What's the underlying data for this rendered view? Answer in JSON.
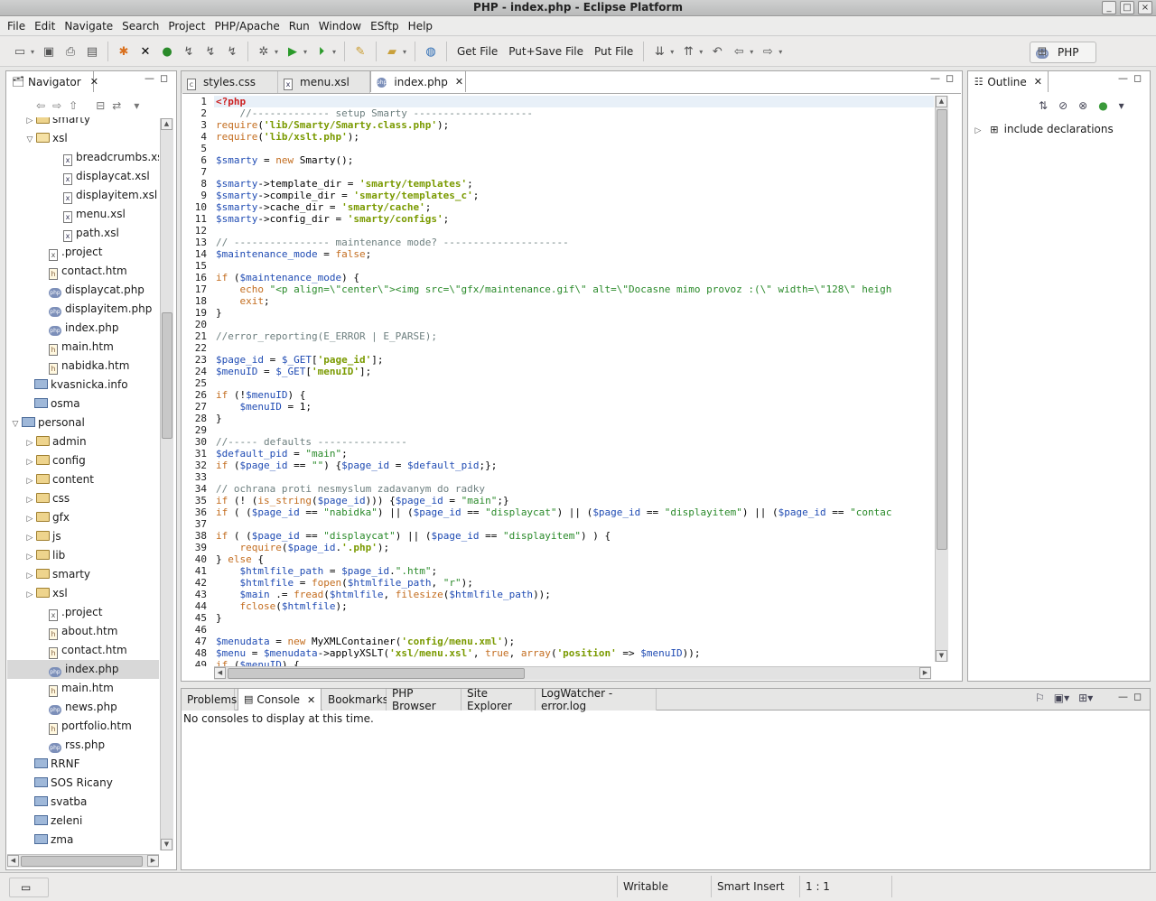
{
  "window": {
    "title": "PHP - index.php - Eclipse Platform"
  },
  "menu": [
    "File",
    "Edit",
    "Navigate",
    "Search",
    "Project",
    "PHP/Apache",
    "Run",
    "Window",
    "ESftp",
    "Help"
  ],
  "toolbar": {
    "get_file": "Get File",
    "put_save_file": "Put+Save File",
    "put_file": "Put File",
    "perspective": "PHP"
  },
  "navigator": {
    "title": "Navigator",
    "items": [
      {
        "label": "smarty",
        "type": "folder",
        "level": 1,
        "expander": "collapsed"
      },
      {
        "label": "xsl",
        "type": "folder",
        "level": 1,
        "expander": "expanded"
      },
      {
        "label": "breadcrumbs.xsl",
        "type": "xsl",
        "level": 2
      },
      {
        "label": "displaycat.xsl",
        "type": "xsl",
        "level": 2
      },
      {
        "label": "displayitem.xsl",
        "type": "xsl",
        "level": 2
      },
      {
        "label": "menu.xsl",
        "type": "xsl",
        "level": 2
      },
      {
        "label": "path.xsl",
        "type": "xsl",
        "level": 2
      },
      {
        "label": ".project",
        "type": "projectfile",
        "level": 1
      },
      {
        "label": "contact.htm",
        "type": "htm",
        "level": 1
      },
      {
        "label": "displaycat.php",
        "type": "php",
        "level": 1
      },
      {
        "label": "displayitem.php",
        "type": "php",
        "level": 1
      },
      {
        "label": "index.php",
        "type": "php",
        "level": 1
      },
      {
        "label": "main.htm",
        "type": "htm",
        "level": 1
      },
      {
        "label": "nabidka.htm",
        "type": "htm",
        "level": 1
      },
      {
        "label": "kvasnicka.info",
        "type": "project",
        "level": 0
      },
      {
        "label": "osma",
        "type": "project",
        "level": 0
      },
      {
        "label": "personal",
        "type": "phpproject",
        "level": 0,
        "expander": "expanded"
      },
      {
        "label": "admin",
        "type": "folder",
        "level": 1,
        "expander": "collapsed"
      },
      {
        "label": "config",
        "type": "folder",
        "level": 1,
        "expander": "collapsed"
      },
      {
        "label": "content",
        "type": "folder",
        "level": 1,
        "expander": "collapsed"
      },
      {
        "label": "css",
        "type": "folder",
        "level": 1,
        "expander": "collapsed"
      },
      {
        "label": "gfx",
        "type": "folder",
        "level": 1,
        "expander": "collapsed"
      },
      {
        "label": "js",
        "type": "folder",
        "level": 1,
        "expander": "collapsed"
      },
      {
        "label": "lib",
        "type": "folder",
        "level": 1,
        "expander": "collapsed"
      },
      {
        "label": "smarty",
        "type": "folder",
        "level": 1,
        "expander": "collapsed"
      },
      {
        "label": "xsl",
        "type": "folder",
        "level": 1,
        "expander": "collapsed"
      },
      {
        "label": ".project",
        "type": "projectfile",
        "level": 1
      },
      {
        "label": "about.htm",
        "type": "htm",
        "level": 1
      },
      {
        "label": "contact.htm",
        "type": "htm",
        "level": 1
      },
      {
        "label": "index.php",
        "type": "php",
        "level": 1,
        "selected": true
      },
      {
        "label": "main.htm",
        "type": "htm",
        "level": 1
      },
      {
        "label": "news.php",
        "type": "php",
        "level": 1
      },
      {
        "label": "portfolio.htm",
        "type": "htm",
        "level": 1
      },
      {
        "label": "rss.php",
        "type": "php",
        "level": 1
      },
      {
        "label": "RRNF",
        "type": "project",
        "level": 0
      },
      {
        "label": "SOS Ricany",
        "type": "project",
        "level": 0
      },
      {
        "label": "svatba",
        "type": "project",
        "level": 0
      },
      {
        "label": "zeleni",
        "type": "project",
        "level": 0
      },
      {
        "label": "zma",
        "type": "project",
        "level": 0
      }
    ]
  },
  "editor": {
    "tabs": [
      {
        "label": "styles.css",
        "icon": "css-file-icon"
      },
      {
        "label": "menu.xsl",
        "icon": "xsl-file-icon"
      },
      {
        "label": "index.php",
        "icon": "php-file-icon",
        "active": true
      }
    ],
    "lines": [
      "<?php",
      "    //------------- setup Smarty --------------------",
      "require('lib/Smarty/Smarty.class.php');",
      "require('lib/xslt.php');",
      "",
      "$smarty = new Smarty();",
      "",
      "$smarty->template_dir = 'smarty/templates';",
      "$smarty->compile_dir = 'smarty/templates_c';",
      "$smarty->cache_dir = 'smarty/cache';",
      "$smarty->config_dir = 'smarty/configs';",
      "",
      "// ---------------- maintenance mode? ---------------------",
      "$maintenance_mode = false;",
      "",
      "if ($maintenance_mode) {",
      "    echo \"<p align=\\\"center\\\"><img src=\\\"gfx/maintenance.gif\\\" alt=\\\"Docasne mimo provoz :(\\\" width=\\\"128\\\" heigh",
      "    exit;",
      "}",
      "",
      "//error_reporting(E_ERROR | E_PARSE);",
      "",
      "$page_id = $_GET['page_id'];",
      "$menuID = $_GET['menuID'];",
      "",
      "if (!$menuID) {",
      "    $menuID = 1;",
      "}",
      "",
      "//----- defaults ---------------",
      "$default_pid = \"main\";",
      "if ($page_id == \"\") {$page_id = $default_pid;};",
      "",
      "// ochrana proti nesmyslum zadavanym do radky",
      "if (! (is_string($page_id))) {$page_id = \"main\";}",
      "if ( ($page_id == \"nabidka\") || ($page_id == \"displaycat\") || ($page_id == \"displayitem\") || ($page_id == \"contac",
      "",
      "if ( ($page_id == \"displaycat\") || ($page_id == \"displayitem\") ) {",
      "    require($page_id.'.php');",
      "} else {",
      "    $htmlfile_path = $page_id.\".htm\";",
      "    $htmlfile = fopen($htmlfile_path, \"r\");",
      "    $main .= fread($htmlfile, filesize($htmlfile_path));",
      "    fclose($htmlfile);",
      "}",
      "",
      "$menudata = new MyXMLContainer('config/menu.xml');",
      "$menu = $menudata->applyXSLT('xsl/menu.xsl', true, array('position' => $menuID));",
      "if ($menuID) {"
    ]
  },
  "outline": {
    "title": "Outline",
    "items": [
      {
        "label": "include declarations"
      }
    ]
  },
  "bottom": {
    "tabs": [
      {
        "label": "Problems"
      },
      {
        "label": "Console",
        "active": true
      },
      {
        "label": "Bookmarks"
      },
      {
        "label": "PHP Browser"
      },
      {
        "label": "Site Explorer"
      },
      {
        "label": "LogWatcher - error.log"
      }
    ],
    "message": "No consoles to display at this time."
  },
  "status": {
    "writable": "Writable",
    "insert_mode": "Smart Insert",
    "position": "1 : 1"
  },
  "colors": {
    "keyword": "#c36d1f",
    "variable": "#1f4bb3",
    "string": "#7a9a00",
    "comment": "#6d7f7f",
    "php_tag": "#cc2020"
  }
}
